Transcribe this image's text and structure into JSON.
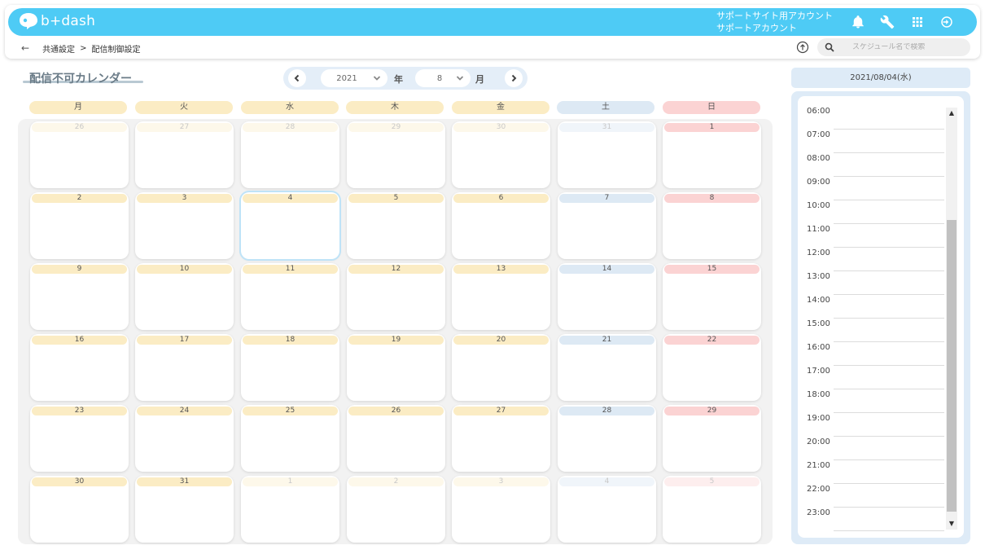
{
  "header": {
    "logo_text": "b+dash",
    "account_line1": "サポートサイト用アカウント",
    "account_line2": "サポートアカウント",
    "icons": [
      "bell-icon",
      "wrench-icon",
      "apps-grid-icon",
      "logout-icon"
    ]
  },
  "breadcrumb": {
    "back": "←",
    "items": [
      "共通設定",
      "配信制御設定"
    ],
    "separator": ">"
  },
  "search": {
    "placeholder": "スケジュール名で検索"
  },
  "page_title": "配信不可カレンダー",
  "nav": {
    "year": "2021",
    "year_label": "年",
    "month": "8",
    "month_label": "月"
  },
  "weekdays": [
    "月",
    "火",
    "水",
    "木",
    "金",
    "土",
    "日"
  ],
  "calendar": {
    "weeks": [
      [
        "26",
        "27",
        "28",
        "29",
        "30",
        "31",
        "1"
      ],
      [
        "2",
        "3",
        "4",
        "5",
        "6",
        "7",
        "8"
      ],
      [
        "9",
        "10",
        "11",
        "12",
        "13",
        "14",
        "15"
      ],
      [
        "16",
        "17",
        "18",
        "19",
        "20",
        "21",
        "22"
      ],
      [
        "23",
        "24",
        "25",
        "26",
        "27",
        "28",
        "29"
      ],
      [
        "30",
        "31",
        "1",
        "2",
        "3",
        "4",
        "5"
      ]
    ],
    "selected_day": "4"
  },
  "side_panel": {
    "date": "2021/08/04(水)",
    "hours": [
      "06:00",
      "07:00",
      "08:00",
      "09:00",
      "10:00",
      "11:00",
      "12:00",
      "13:00",
      "14:00",
      "15:00",
      "16:00",
      "17:00",
      "18:00",
      "19:00",
      "20:00",
      "21:00",
      "22:00",
      "23:00"
    ]
  },
  "colors": {
    "header": "#4ecbf5",
    "weekday_tag": "#fbecc4",
    "saturday_tag": "#dde9f4",
    "sunday_tag": "#fbd3d3",
    "selected_border": "#bfe3f7"
  }
}
